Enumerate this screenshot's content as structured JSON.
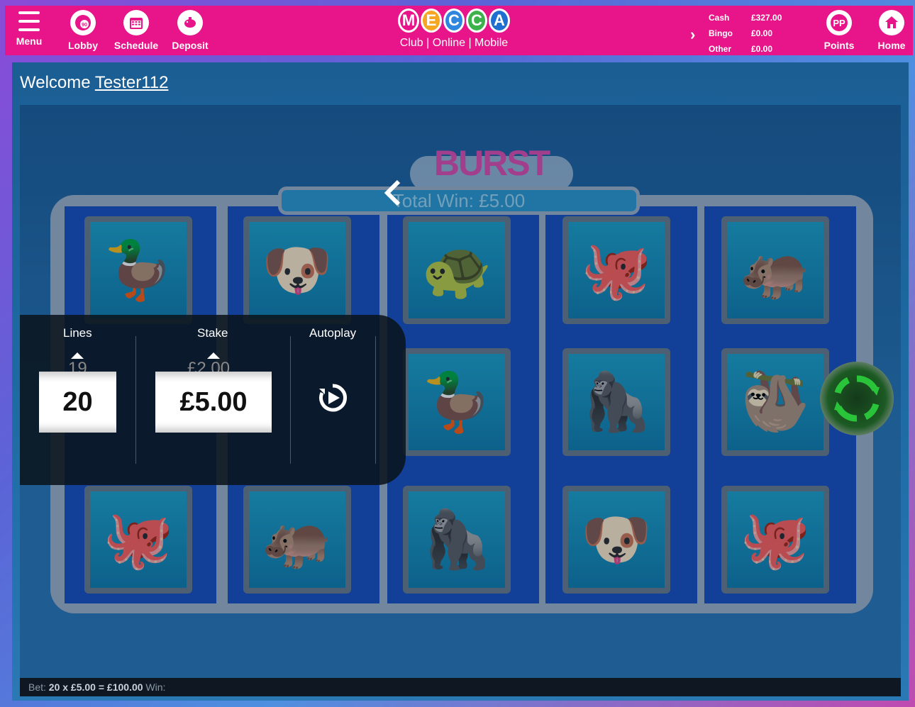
{
  "header": {
    "menu_label": "Menu",
    "lobby_label": "Lobby",
    "schedule_label": "Schedule",
    "deposit_label": "Deposit",
    "logo_text": "MECCA",
    "tagline": "Club | Online | Mobile",
    "balances": [
      {
        "label": "Cash",
        "value": "£327.00"
      },
      {
        "label": "Bingo",
        "value": "£0.00"
      },
      {
        "label": "Other",
        "value": "£0.00"
      }
    ],
    "points_label": "Points",
    "home_label": "Home",
    "brand_color": "#e8148a"
  },
  "welcome": {
    "prefix": "Welcome",
    "username": "Tester112"
  },
  "game": {
    "title": "BURST",
    "total_win": "Total Win: £5.00",
    "reels": [
      [
        "duck",
        "octopus"
      ],
      [
        "pug",
        "hippo"
      ],
      [
        "turtle",
        "duck",
        "gorilla"
      ],
      [
        "octopus",
        "gorilla",
        "pug"
      ],
      [
        "hippo",
        "sloth",
        "octopus"
      ]
    ]
  },
  "controls": {
    "lines_label": "Lines",
    "stake_label": "Stake",
    "autoplay_label": "Autoplay",
    "lines_prev": "19",
    "lines_value": "20",
    "stake_prev": "£2.00",
    "stake_value": "£5.00"
  },
  "status_bar": {
    "bet_prefix": "Bet:",
    "bet_value": "20 x £5.00 = £100.00",
    "win_label": "Win:"
  }
}
